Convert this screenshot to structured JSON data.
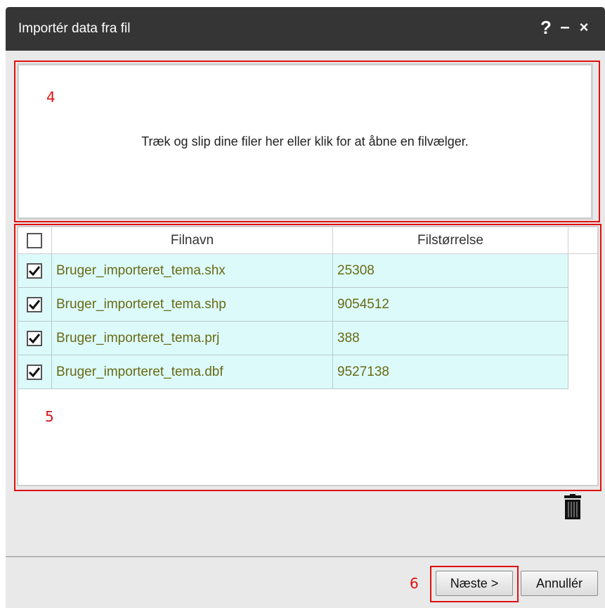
{
  "dialog": {
    "title": "Importér data fra fil",
    "help_label": "?",
    "minimize_label": "–",
    "close_label": "×"
  },
  "dropzone": {
    "text": "Træk og slip dine filer her eller klik for at åbne en filvælger."
  },
  "table": {
    "headers": [
      "Filnavn",
      "Filstørrelse"
    ],
    "rows": [
      {
        "checked": true,
        "name": "Bruger_importeret_tema.shx",
        "size": "25308"
      },
      {
        "checked": true,
        "name": "Bruger_importeret_tema.shp",
        "size": "9054512"
      },
      {
        "checked": true,
        "name": "Bruger_importeret_tema.prj",
        "size": "388"
      },
      {
        "checked": true,
        "name": "Bruger_importeret_tema.dbf",
        "size": "9527138"
      }
    ]
  },
  "annotations": {
    "dropzone": "4",
    "filelist": "5",
    "next": "6"
  },
  "buttons": {
    "next": "Næste >",
    "cancel": "Annullér"
  },
  "icons": {
    "delete": "trash-icon"
  },
  "colors": {
    "titlebar": "#353535",
    "row_bg": "#dcfafa",
    "row_text": "#6a6a14",
    "annotation": "#e01010"
  }
}
